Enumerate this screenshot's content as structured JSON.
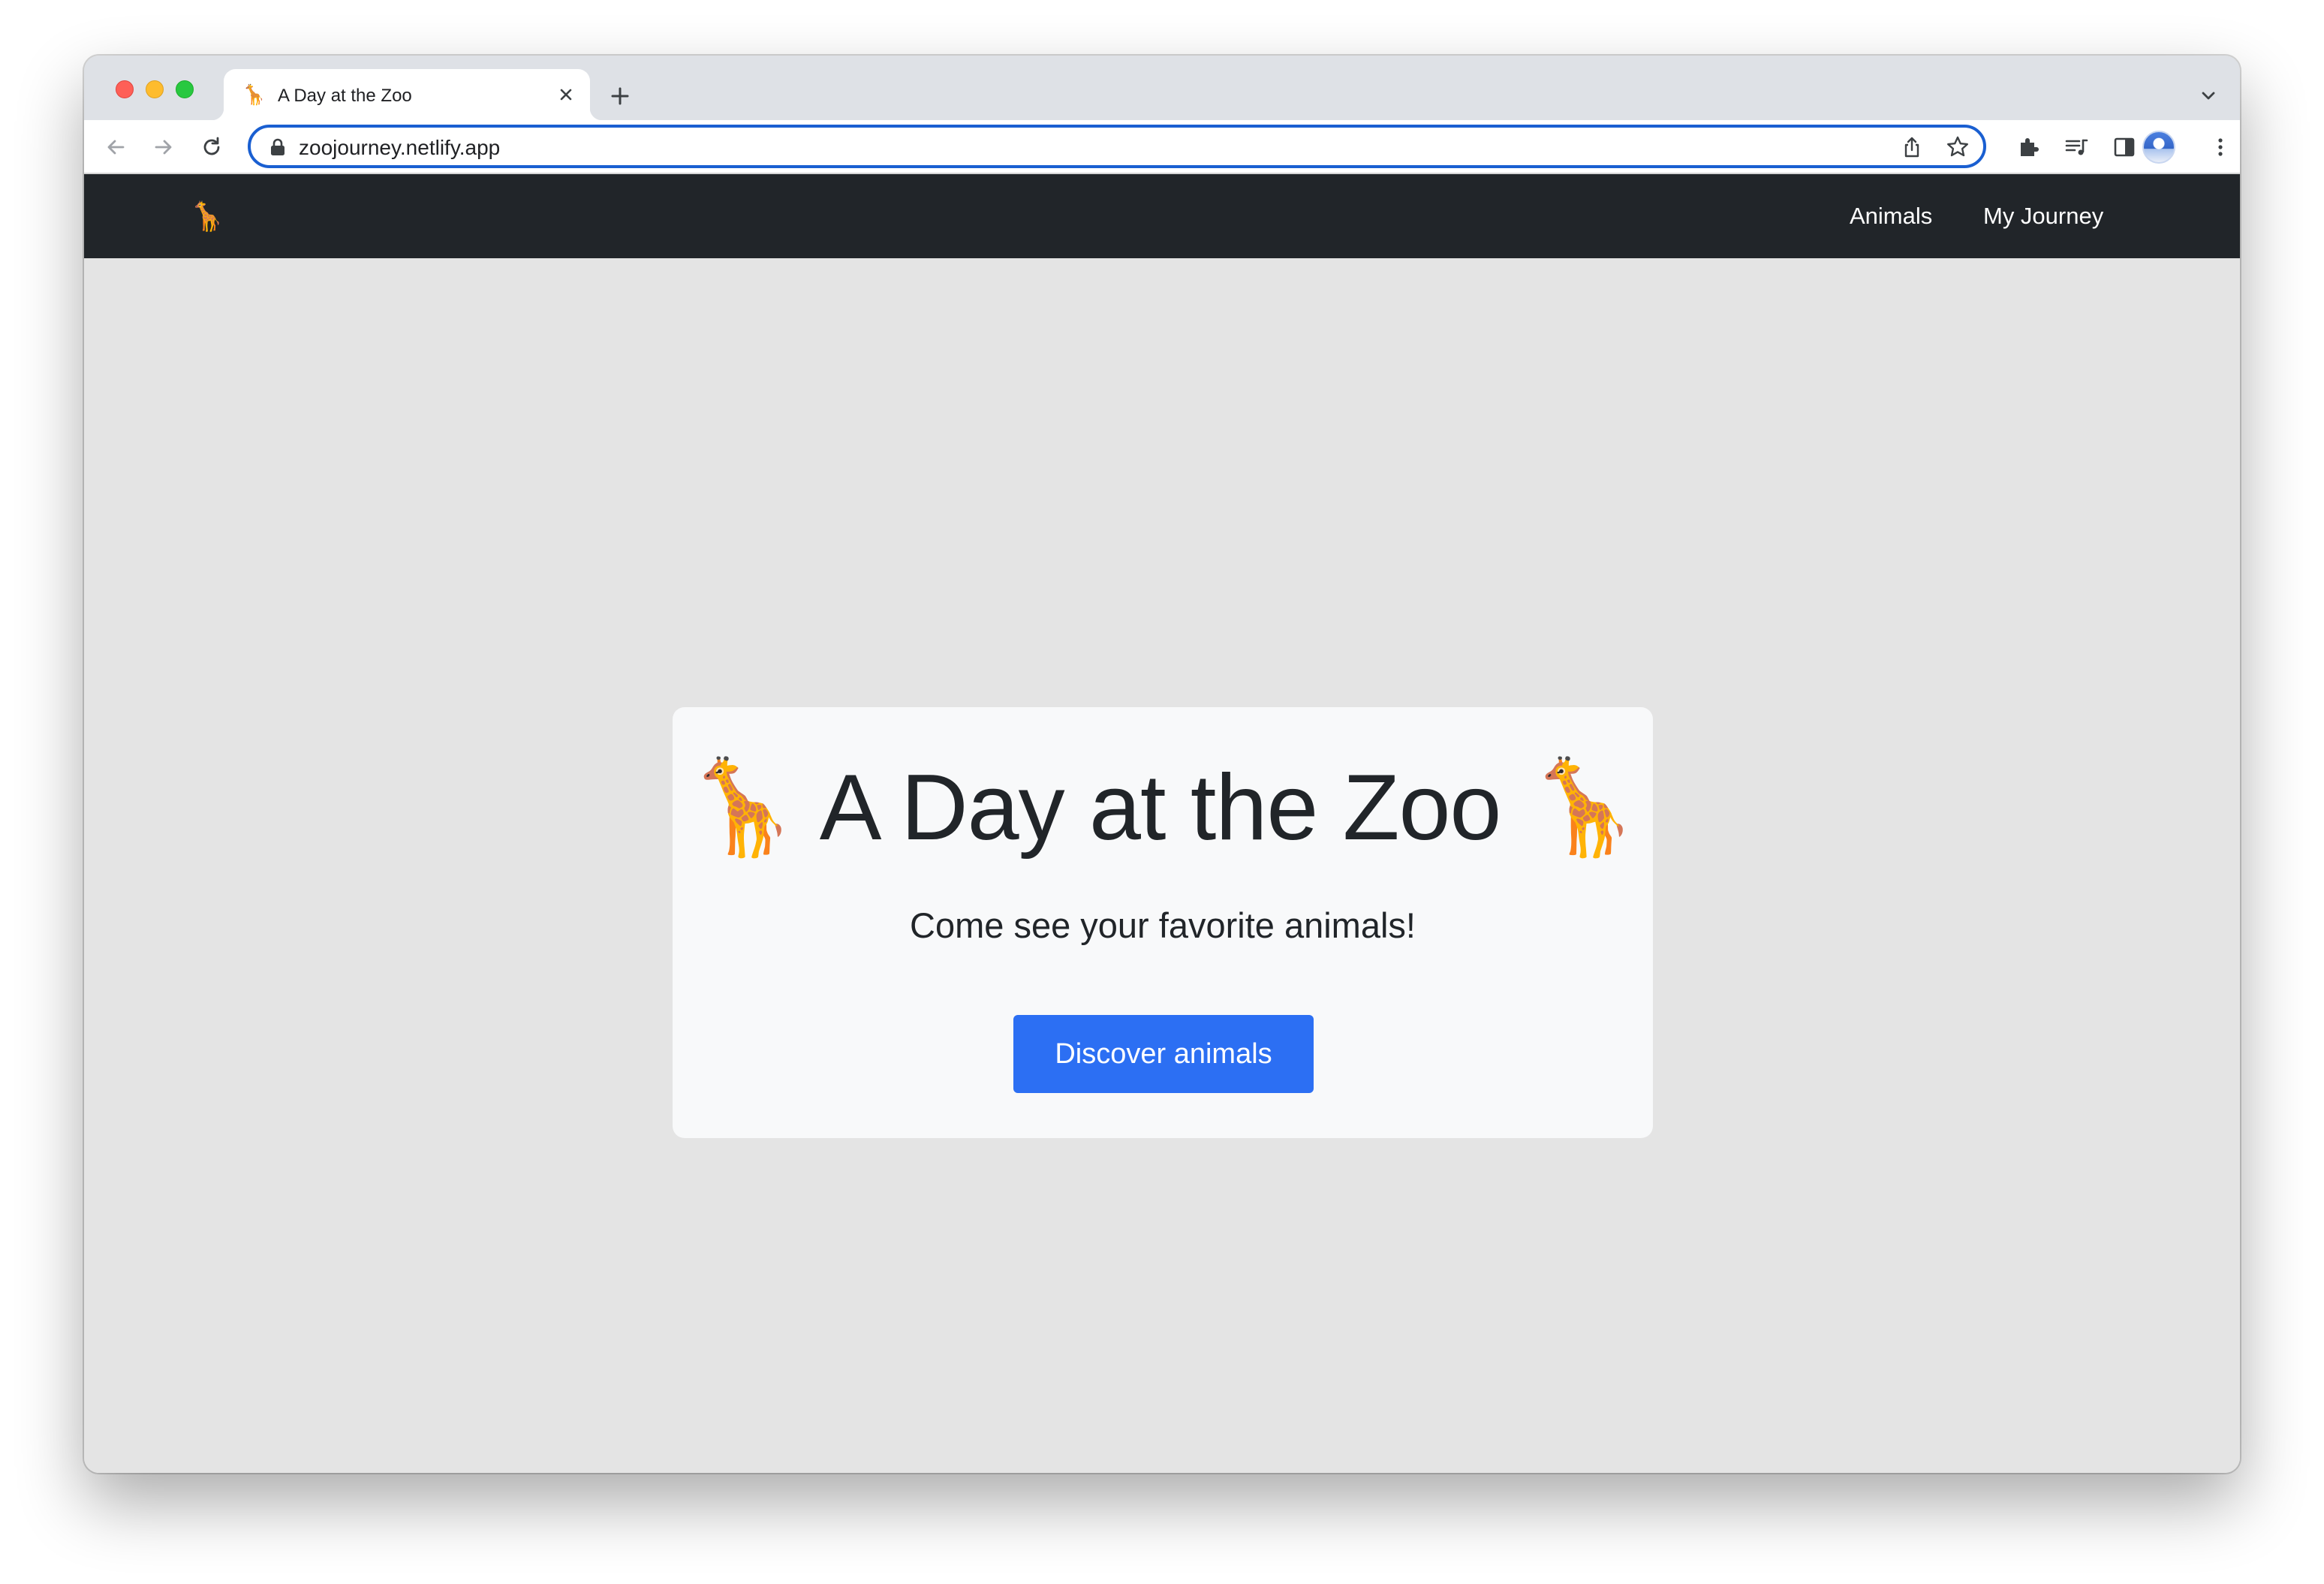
{
  "browser": {
    "tab": {
      "favicon": "🦒",
      "title": "A Day at the Zoo"
    },
    "address_bar": {
      "url": "zoojourney.netlify.app"
    },
    "icons": {
      "tab_close": "close-icon",
      "new_tab": "plus-icon",
      "tab_list": "chevron-down-icon",
      "back": "arrow-left-icon",
      "forward": "arrow-right-icon",
      "reload": "reload-icon",
      "lock": "lock-icon",
      "share": "share-icon",
      "bookmark": "star-icon",
      "extensions": "puzzle-icon",
      "media": "media-queue-icon",
      "side_panel": "side-panel-icon",
      "menu": "kebab-menu-icon"
    }
  },
  "navbar": {
    "brand_icon": "🦒",
    "links": [
      {
        "label": "Animals"
      },
      {
        "label": "My Journey"
      }
    ]
  },
  "hero": {
    "title": "🦒 A Day at the Zoo 🦒",
    "subtitle": "Come see your favorite animals!",
    "button_label": "Discover animals"
  },
  "colors": {
    "navbar_bg": "#212529",
    "page_bg": "#e4e4e4",
    "card_bg": "#f8f9fa",
    "primary_button": "#2c6ff3",
    "omnibox_focus": "#1a5fd1"
  }
}
